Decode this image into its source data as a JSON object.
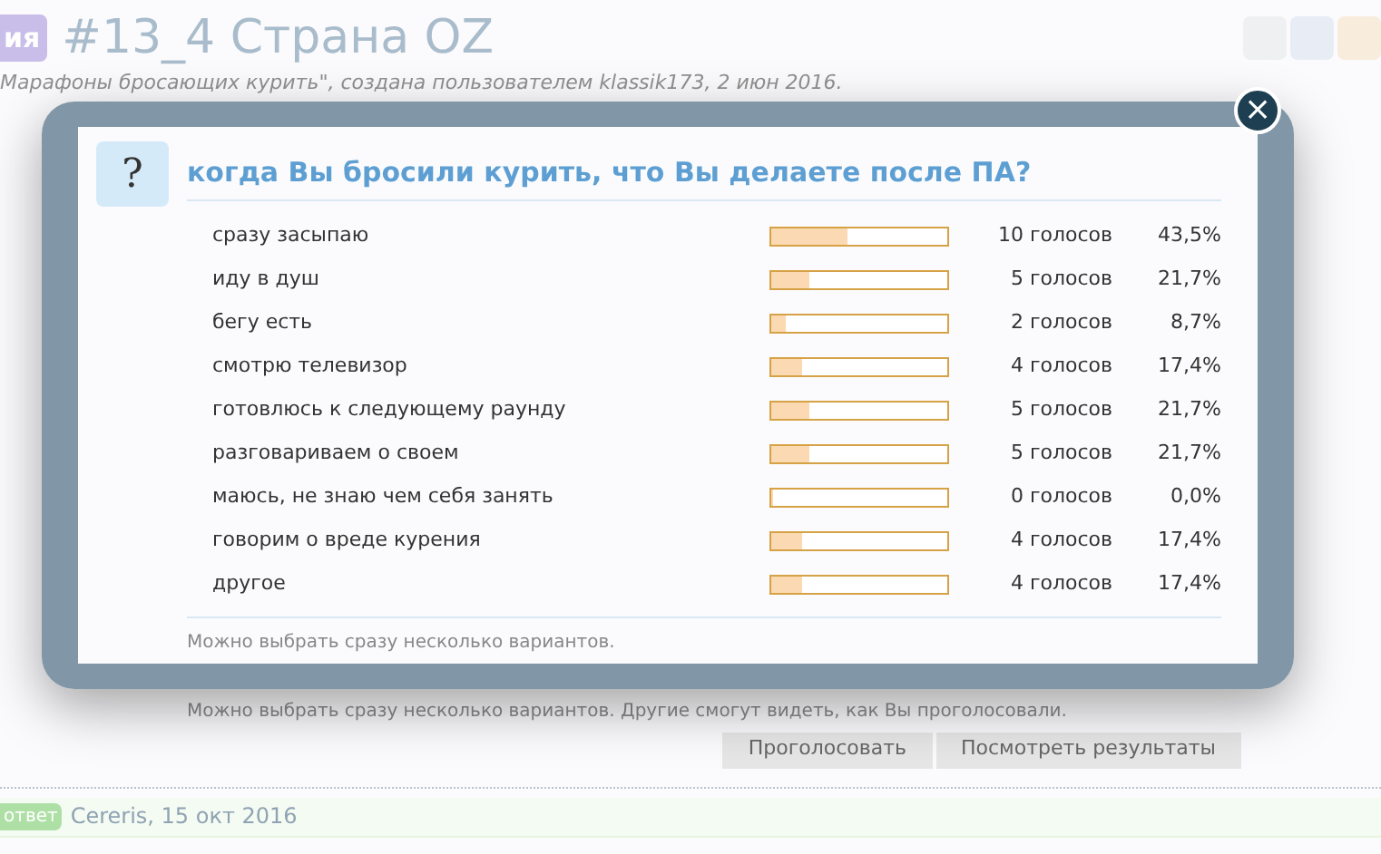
{
  "page": {
    "prefix_badge": "ия",
    "title": "#13_4 Страна OZ",
    "subtitle": "Марафоны бросающих курить\", создана пользователем klassik173, 2 июн 2016.",
    "poll_note": "Можно выбрать сразу несколько вариантов. Другие смогут видеть, как Вы проголосовали.",
    "buttons": [
      "Проголосовать",
      "Посмотреть результаты"
    ],
    "reply": {
      "badge": "ответ",
      "author_date": "Cereris, 15 окт 2016"
    }
  },
  "modal": {
    "icon_text": "?",
    "question": "когда Вы бросили курить, что Вы делаете после ПА?",
    "results": [
      {
        "option": "сразу засыпаю",
        "level": 0.435,
        "votes": "10 голосов",
        "percent": "43,5%"
      },
      {
        "option": "иду в душ",
        "level": 0.217,
        "votes": "5 голосов",
        "percent": "21,7%"
      },
      {
        "option": "бегу есть",
        "level": 0.087,
        "votes": "2 голосов",
        "percent": "8,7%"
      },
      {
        "option": "смотрю телевизор",
        "level": 0.174,
        "votes": "4 голосов",
        "percent": "17,4%"
      },
      {
        "option": "готовлюсь к следующему раунду",
        "level": 0.217,
        "votes": "5 голосов",
        "percent": "21,7%"
      },
      {
        "option": "разговариваем о своем",
        "level": 0.217,
        "votes": "5 голосов",
        "percent": "21,7%"
      },
      {
        "option": "маюсь, не знаю чем себя занять",
        "level": 0,
        "votes": "0 голосов",
        "percent": "0,0%"
      },
      {
        "option": "говорим о вреде курения",
        "level": 0.174,
        "votes": "4 голосов",
        "percent": "17,4%"
      },
      {
        "option": "другое",
        "level": 0.174,
        "votes": "4 голосов",
        "percent": "17,4%"
      }
    ],
    "footnote": "Можно выбрать сразу несколько вариантов.",
    "close": "×"
  }
}
